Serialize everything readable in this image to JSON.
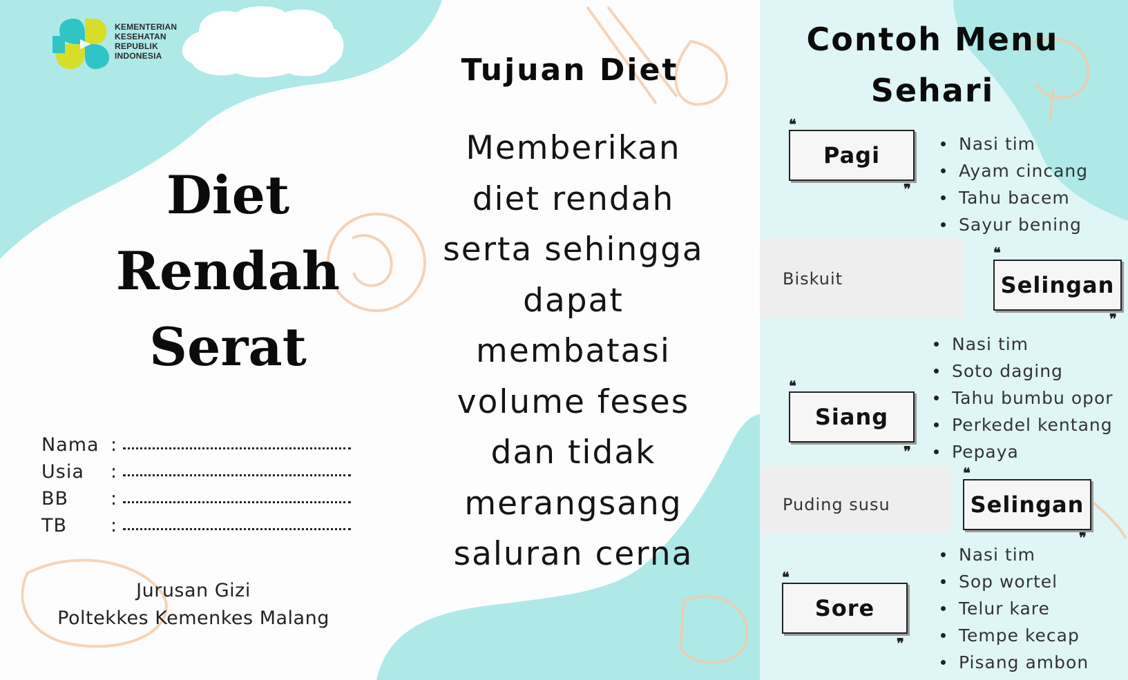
{
  "colors": {
    "teal": "#aee9e8",
    "teal_light": "#c9f1f1",
    "peach_sketch": "#f3c9a8",
    "text": "#111111"
  },
  "header": {
    "logo_icon": "kemenkes-logo-icon",
    "logo_lines": [
      "KEMENTERIAN",
      "KESEHATAN",
      "REPUBLIK",
      "INDONESIA"
    ]
  },
  "left": {
    "title_lines": [
      "Diet",
      "Rendah",
      "Serat"
    ],
    "fields": [
      {
        "label": "Nama",
        "colon": ":"
      },
      {
        "label": "Usia",
        "colon": ":"
      },
      {
        "label": "BB",
        "colon": ":"
      },
      {
        "label": "TB",
        "colon": ":"
      }
    ],
    "institution": [
      "Jurusan Gizi",
      "Poltekkes Kemenkes Malang"
    ]
  },
  "middle": {
    "heading": "Tujuan Diet",
    "body_lines": [
      "Memberikan",
      "diet rendah",
      "serta sehingga",
      "dapat",
      "membatasi",
      "volume feses",
      "dan tidak",
      "merangsang",
      "saluran cerna"
    ]
  },
  "right": {
    "title_lines": [
      "Contoh Menu",
      "Sehari"
    ],
    "meals": {
      "pagi": {
        "label": "Pagi",
        "items": [
          "Nasi tim",
          "Ayam cincang",
          "Tahu bacem",
          "Sayur bening"
        ]
      },
      "selingan1": {
        "label": "Selingan",
        "snack": "Biskuit"
      },
      "siang": {
        "label": "Siang",
        "items": [
          "Nasi tim",
          "Soto daging",
          "Tahu bumbu opor",
          "Perkedel kentang",
          "Pepaya"
        ]
      },
      "selingan2": {
        "label": "Selingan",
        "snack": "Puding susu"
      },
      "sore": {
        "label": "Sore",
        "items": [
          "Nasi tim",
          "Sop wortel",
          "Telur kare",
          "Tempe kecap",
          "Pisang ambon"
        ]
      }
    }
  }
}
